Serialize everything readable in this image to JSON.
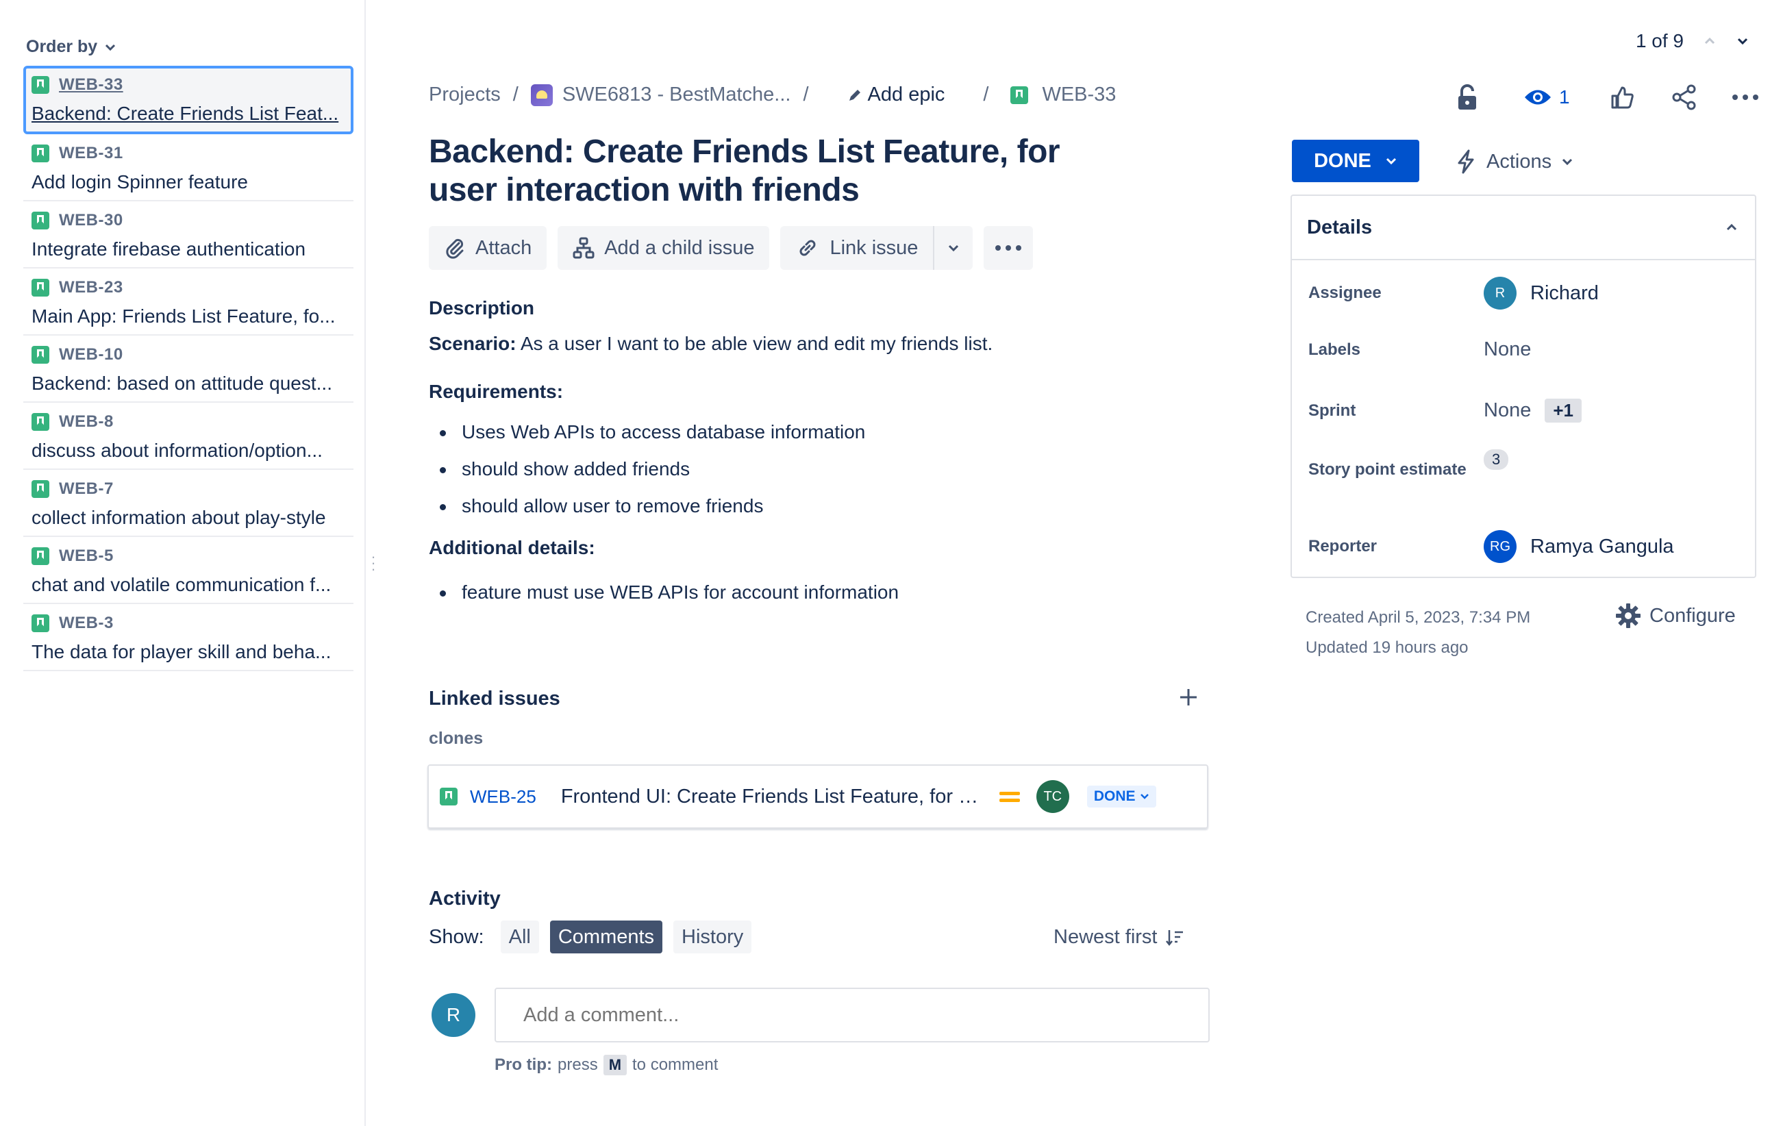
{
  "sidebar": {
    "order_by": "Order by",
    "issues": [
      {
        "key": "WEB-33",
        "summary": "Backend: Create Friends List Feat..."
      },
      {
        "key": "WEB-31",
        "summary": "Add login Spinner feature"
      },
      {
        "key": "WEB-30",
        "summary": "Integrate firebase authentication"
      },
      {
        "key": "WEB-23",
        "summary": "Main App: Friends List Feature, fo..."
      },
      {
        "key": "WEB-10",
        "summary": "Backend: based on attitude quest..."
      },
      {
        "key": "WEB-8",
        "summary": "discuss about information/option..."
      },
      {
        "key": "WEB-7",
        "summary": "collect information about play-style"
      },
      {
        "key": "WEB-5",
        "summary": "chat and volatile communication f..."
      },
      {
        "key": "WEB-3",
        "summary": "The data for player skill and beha..."
      }
    ]
  },
  "pager": {
    "text": "1 of 9"
  },
  "breadcrumb": {
    "projects": "Projects",
    "sep": "/",
    "project": "SWE6813 - BestMatche...",
    "add_epic": "Add epic",
    "issue_key": "WEB-33"
  },
  "header_actions": {
    "watch_count": "1"
  },
  "issue": {
    "title": "Backend: Create Friends List Feature, for user interaction with friends",
    "status": "DONE",
    "actions_label": "Actions"
  },
  "toolbar": {
    "attach": "Attach",
    "add_child": "Add a child issue",
    "link_issue": "Link issue"
  },
  "description": {
    "label": "Description",
    "scenario_label": "Scenario:",
    "scenario_text": " As a user I want to be able view and edit my friends list.",
    "requirements_label": "Requirements:",
    "requirements": [
      "Uses Web APIs to access database information",
      "should show added friends",
      "should allow user to remove friends"
    ],
    "additional_label": "Additional details:",
    "additional": [
      "feature must use WEB APIs for account information"
    ]
  },
  "linked": {
    "title": "Linked issues",
    "relation": "clones",
    "item": {
      "key": "WEB-25",
      "summary": "Frontend UI: Create Friends List Feature, for u...",
      "assignee_initials": "TC",
      "status": "DONE"
    }
  },
  "activity": {
    "title": "Activity",
    "show_label": "Show:",
    "filters": [
      "All",
      "Comments",
      "History"
    ],
    "active_filter": "Comments",
    "sort": "Newest first",
    "avatar_initial": "R",
    "comment_placeholder": "Add a comment...",
    "pro_tip_label": "Pro tip:",
    "pro_tip_press": "press",
    "pro_tip_key": "M",
    "pro_tip_suffix": "to comment"
  },
  "details": {
    "title": "Details",
    "assignee_label": "Assignee",
    "assignee": "Richard",
    "assignee_initial": "R",
    "labels_label": "Labels",
    "labels": "None",
    "sprint_label": "Sprint",
    "sprint": "None",
    "sprint_extra": "+1",
    "story_points_label": "Story point estimate",
    "story_points": "3",
    "reporter_label": "Reporter",
    "reporter": "Ramya Gangula",
    "reporter_initials": "RG"
  },
  "meta": {
    "created": "Created April 5, 2023, 7:34 PM",
    "updated": "Updated 19 hours ago",
    "configure": "Configure"
  },
  "colors": {
    "primary": "#0052cc",
    "story_green": "#36b37e",
    "selection_border": "#4c9aff",
    "priority_medium": "#ffab00"
  }
}
